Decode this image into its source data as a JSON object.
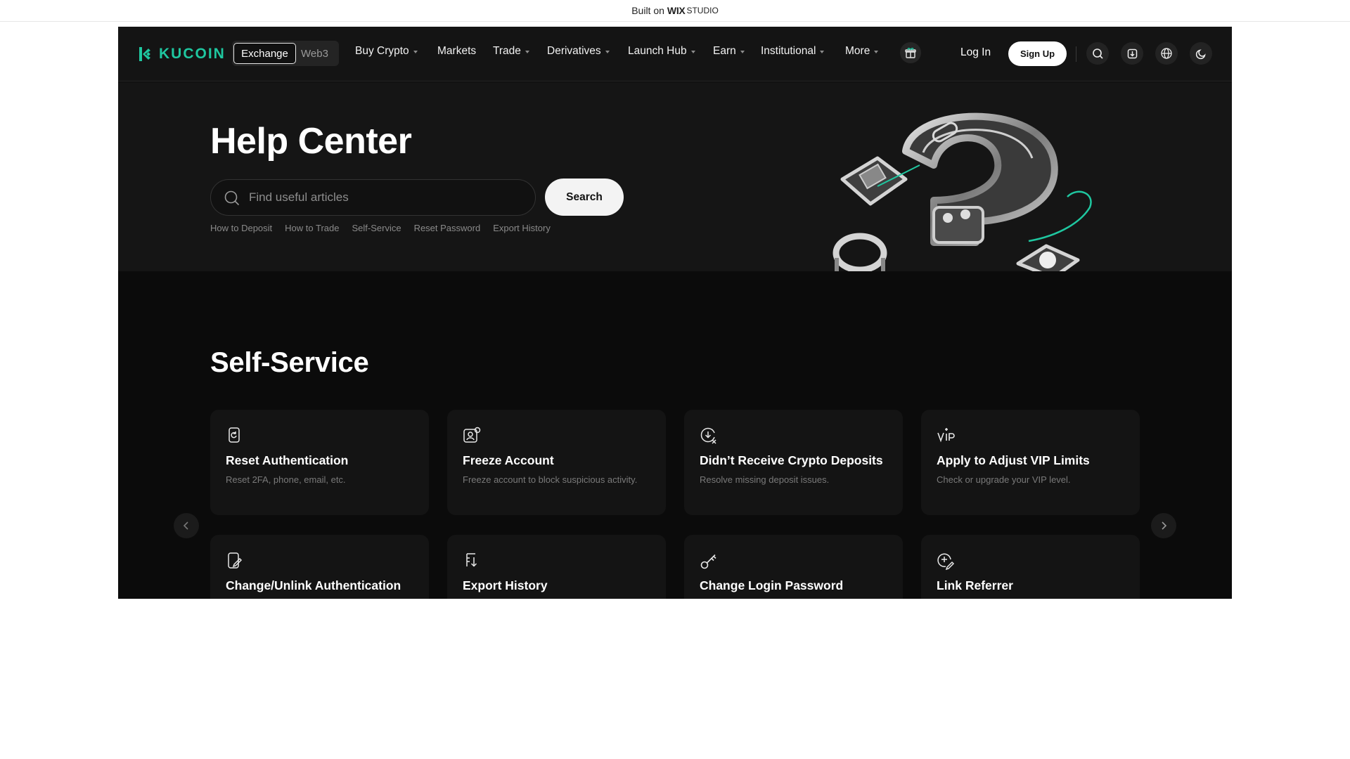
{
  "wix_bar": {
    "prefix": "Built on",
    "brand": "WIX",
    "suffix": "STUDIO"
  },
  "nav": {
    "logo": "KUCOIN",
    "segment": {
      "active": "Exchange",
      "inactive": "Web3"
    },
    "menu": [
      {
        "label": "Buy Crypto",
        "dropdown": true
      },
      {
        "label": "Markets",
        "dropdown": false
      },
      {
        "label": "Trade",
        "dropdown": true
      },
      {
        "label": "Derivatives",
        "dropdown": true
      },
      {
        "label": "Launch Hub",
        "dropdown": true
      },
      {
        "label": "Earn",
        "dropdown": true
      },
      {
        "label": "Institutional",
        "dropdown": true
      },
      {
        "label": "More",
        "dropdown": true
      }
    ],
    "login": "Log In",
    "signup": "Sign Up",
    "icons": [
      "gift-icon",
      "search-icon",
      "download-icon",
      "globe-icon",
      "moon-icon"
    ]
  },
  "hero": {
    "title": "Help Center",
    "search_placeholder": "Find useful articles",
    "search_button": "Search",
    "quick_links": [
      "How to Deposit",
      "How to Trade",
      "Self-Service",
      "Reset Password",
      "Export History"
    ]
  },
  "self_service": {
    "title": "Self-Service",
    "cards": [
      {
        "icon": "phone-reset-icon",
        "title": "Reset Authentication",
        "desc": "Reset 2FA, phone, email, etc."
      },
      {
        "icon": "freeze-user-icon",
        "title": "Freeze Account",
        "desc": "Freeze account to block suspicious activity."
      },
      {
        "icon": "deposit-missing-icon",
        "title": "Didn’t Receive Crypto Deposits",
        "desc": "Resolve missing deposit issues."
      },
      {
        "icon": "vip-icon",
        "title": "Apply to Adjust VIP Limits",
        "desc": "Check or upgrade your VIP level."
      },
      {
        "icon": "unlink-auth-icon",
        "title": "Change/Unlink Authentication",
        "desc": ""
      },
      {
        "icon": "export-history-icon",
        "title": "Export History",
        "desc": ""
      },
      {
        "icon": "key-icon",
        "title": "Change Login Password",
        "desc": ""
      },
      {
        "icon": "link-referrer-icon",
        "title": "Link Referrer",
        "desc": ""
      }
    ]
  },
  "colors": {
    "brand": "#1fc7a0",
    "background": "#0b0b0b",
    "hero": "#151515"
  }
}
